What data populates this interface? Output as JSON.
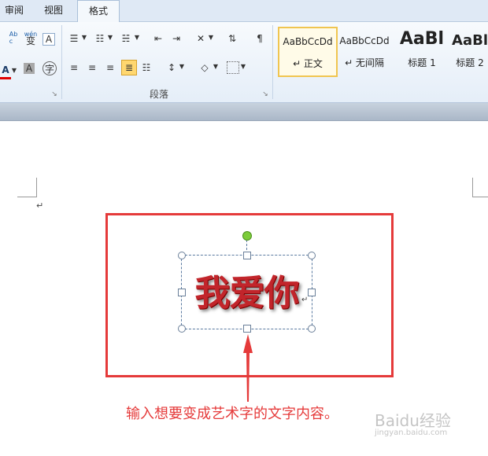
{
  "tabs": [
    {
      "label": "审阅"
    },
    {
      "label": "视图"
    },
    {
      "label": "格式"
    }
  ],
  "ribbon": {
    "groups": {
      "paragraph_label": "段落"
    },
    "styles": [
      {
        "sample": "AaBbCcDd",
        "label": "↵ 正文"
      },
      {
        "sample": "AaBbCcDd",
        "label": "↵ 无间隔"
      },
      {
        "sample": "AaBl",
        "label": "标题 1"
      },
      {
        "sample": "AaBl",
        "label": "标题 2"
      }
    ],
    "font_icons": {
      "phonetic": "wén",
      "phonetic_char": "变",
      "border": "A",
      "color_a": "A",
      "shading": "A",
      "enclose": "字"
    }
  },
  "document": {
    "paragraph_mark": "↵",
    "wordart_text": "我爱你",
    "caption": "输入想要变成艺术字的文字内容。"
  },
  "watermark": {
    "brand": "Baidu经验",
    "url": "jingyan.baidu.com"
  }
}
